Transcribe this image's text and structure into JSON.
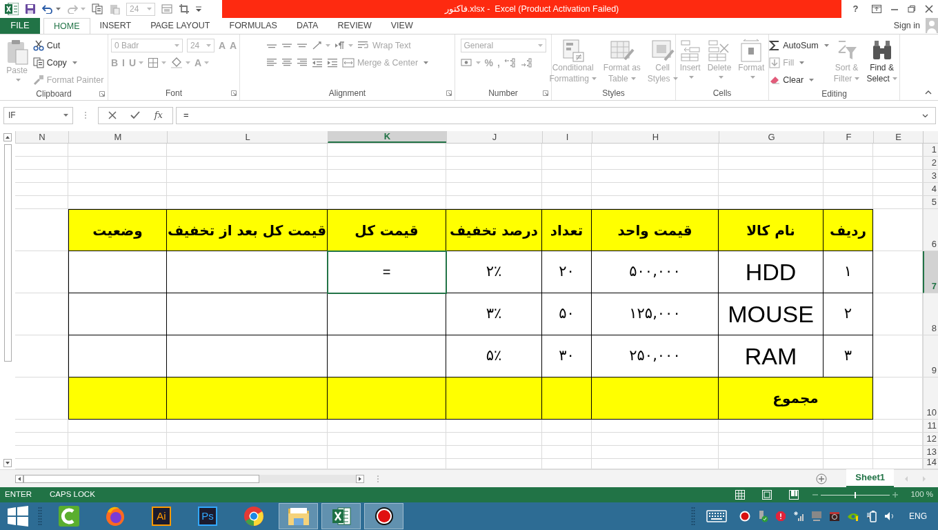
{
  "title_bar": {
    "font_size": "24",
    "title": "فاکتور.xlsx -  Excel (Product Activation Failed)",
    "help": "?"
  },
  "tabs": [
    {
      "label": "FILE",
      "kind": "file",
      "selected": false
    },
    {
      "label": "HOME",
      "kind": "tab",
      "selected": true
    },
    {
      "label": "INSERT",
      "kind": "tab",
      "selected": false
    },
    {
      "label": "PAGE LAYOUT",
      "kind": "tab",
      "selected": false
    },
    {
      "label": "FORMULAS",
      "kind": "tab",
      "selected": false
    },
    {
      "label": "DATA",
      "kind": "tab",
      "selected": false
    },
    {
      "label": "REVIEW",
      "kind": "tab",
      "selected": false
    },
    {
      "label": "VIEW",
      "kind": "tab",
      "selected": false
    }
  ],
  "account": {
    "label": "Sign in"
  },
  "ribbon": {
    "groups": [
      {
        "label": "Clipboard",
        "launcher": true,
        "columns": [
          {
            "kind": "large",
            "label": "Paste",
            "caret": true,
            "disabled": true
          },
          {
            "kind": "stack",
            "lines": [
              {
                "controls": [
                  {
                    "kind": "button",
                    "label": "Cut",
                    "caret": false,
                    "disabled": false
                  }
                ]
              },
              {
                "controls": [
                  {
                    "kind": "button",
                    "label": "Copy",
                    "caret": true,
                    "disabled": false
                  }
                ]
              },
              {
                "controls": [
                  {
                    "kind": "button",
                    "label": "Format Painter",
                    "caret": false,
                    "disabled": true
                  }
                ]
              }
            ]
          }
        ]
      },
      {
        "label": "Font",
        "launcher": true,
        "columns": [
          {
            "kind": "stack",
            "lines": [
              {
                "controls": [
                  {
                    "kind": "field",
                    "value": "0 Badr",
                    "wide": true,
                    "disabled": true
                  },
                  {
                    "kind": "field",
                    "value": "24",
                    "wide": false,
                    "disabled": true
                  },
                  {
                    "kind": "glyph",
                    "label": "A",
                    "caret": false,
                    "disabled": true
                  },
                  {
                    "kind": "glyph",
                    "label": "A",
                    "caret": false,
                    "disabled": true
                  }
                ]
              },
              {
                "controls": [
                  {
                    "kind": "glyph",
                    "label": "B",
                    "caret": false,
                    "disabled": true
                  },
                  {
                    "kind": "glyph",
                    "label": "I",
                    "caret": false,
                    "disabled": true
                  },
                  {
                    "kind": "glyph",
                    "label": "U",
                    "caret": true,
                    "disabled": true
                  },
                  {
                    "kind": "icon",
                    "caret": true,
                    "disabled": true
                  },
                  {
                    "kind": "icon",
                    "caret": true,
                    "disabled": true
                  },
                  {
                    "kind": "glyph",
                    "label": "A",
                    "caret": true,
                    "disabled": true
                  }
                ]
              }
            ]
          }
        ]
      },
      {
        "label": "Alignment",
        "launcher": true,
        "columns": [
          {
            "kind": "stack",
            "lines": [
              {
                "controls": [
                  {
                    "kind": "icon",
                    "caret": false,
                    "disabled": true
                  },
                  {
                    "kind": "icon",
                    "caret": false,
                    "disabled": true
                  },
                  {
                    "kind": "icon",
                    "caret": false,
                    "disabled": true
                  },
                  {
                    "kind": "icon",
                    "caret": true,
                    "disabled": true
                  },
                  {
                    "kind": "icon",
                    "caret": true,
                    "disabled": true
                  },
                  {
                    "kind": "button",
                    "label": "Wrap Text",
                    "caret": false,
                    "disabled": true
                  }
                ]
              },
              {
                "controls": [
                  {
                    "kind": "icon",
                    "caret": false,
                    "disabled": true
                  },
                  {
                    "kind": "icon",
                    "caret": false,
                    "disabled": true
                  },
                  {
                    "kind": "icon",
                    "caret": false,
                    "disabled": true
                  },
                  {
                    "kind": "icon",
                    "caret": false,
                    "disabled": true
                  },
                  {
                    "kind": "icon",
                    "caret": false,
                    "disabled": true
                  },
                  {
                    "kind": "button",
                    "label": "Merge & Center",
                    "caret": true,
                    "disabled": true
                  }
                ]
              }
            ]
          }
        ]
      },
      {
        "label": "Number",
        "launcher": true,
        "columns": [
          {
            "kind": "stack",
            "lines": [
              {
                "controls": [
                  {
                    "kind": "field",
                    "value": "General",
                    "wide": true,
                    "disabled": true
                  }
                ]
              },
              {
                "controls": [
                  {
                    "kind": "icon",
                    "caret": true,
                    "disabled": true
                  },
                  {
                    "kind": "glyph",
                    "label": "%",
                    "caret": false,
                    "disabled": true
                  },
                  {
                    "kind": "glyph",
                    "label": ",",
                    "caret": false,
                    "disabled": true
                  },
                  {
                    "kind": "icon",
                    "caret": false,
                    "disabled": true
                  },
                  {
                    "kind": "icon",
                    "caret": false,
                    "disabled": true
                  }
                ]
              }
            ]
          }
        ]
      },
      {
        "label": "Styles",
        "launcher": false,
        "columns": [
          {
            "kind": "large",
            "label": "Conditional\nFormatting",
            "caret": true,
            "disabled": true
          },
          {
            "kind": "large",
            "label": "Format as\nTable",
            "caret": true,
            "disabled": true
          },
          {
            "kind": "large",
            "label": "Cell\nStyles",
            "caret": true,
            "disabled": true
          }
        ]
      },
      {
        "label": "Cells",
        "launcher": false,
        "columns": [
          {
            "kind": "large",
            "label": "Insert",
            "caret": true,
            "disabled": true
          },
          {
            "kind": "large",
            "label": "Delete",
            "caret": true,
            "disabled": true
          },
          {
            "kind": "large",
            "label": "Format",
            "caret": true,
            "disabled": true
          }
        ]
      },
      {
        "label": "Editing",
        "launcher": false,
        "columns": [
          {
            "kind": "stack",
            "lines": [
              {
                "controls": [
                  {
                    "kind": "button",
                    "label": "AutoSum",
                    "caret": true,
                    "disabled": false
                  }
                ]
              },
              {
                "controls": [
                  {
                    "kind": "button",
                    "label": "Fill",
                    "caret": true,
                    "disabled": true
                  }
                ]
              },
              {
                "controls": [
                  {
                    "kind": "button",
                    "label": "Clear",
                    "caret": true,
                    "disabled": false
                  }
                ]
              }
            ]
          },
          {
            "kind": "large",
            "label": "Sort &\nFilter",
            "caret": true,
            "disabled": true
          },
          {
            "kind": "large",
            "label": "Find &\nSelect",
            "caret": true,
            "disabled": false
          }
        ]
      }
    ]
  },
  "formula_bar": {
    "name_box": "IF",
    "function_label": "fx",
    "formula": "="
  },
  "sheet": {
    "columns": [
      {
        "label": "N",
        "selected": false
      },
      {
        "label": "M",
        "selected": false
      },
      {
        "label": "L",
        "selected": false
      },
      {
        "label": "K",
        "selected": true
      },
      {
        "label": "J",
        "selected": false
      },
      {
        "label": "I",
        "selected": false
      },
      {
        "label": "H",
        "selected": false
      },
      {
        "label": "G",
        "selected": false
      },
      {
        "label": "F",
        "selected": false
      },
      {
        "label": "E",
        "selected": false
      }
    ],
    "rows": [
      {
        "label": "1",
        "selected": false
      },
      {
        "label": "2",
        "selected": false
      },
      {
        "label": "3",
        "selected": false
      },
      {
        "label": "4",
        "selected": false
      },
      {
        "label": "5",
        "selected": false
      },
      {
        "label": "6",
        "selected": false
      },
      {
        "label": "7",
        "selected": true
      },
      {
        "label": "8",
        "selected": false
      },
      {
        "label": "9",
        "selected": false
      },
      {
        "label": "10",
        "selected": false
      },
      {
        "label": "11",
        "selected": false
      },
      {
        "label": "12",
        "selected": false
      },
      {
        "label": "13",
        "selected": false
      },
      {
        "label": "14",
        "selected": false
      }
    ],
    "invoice": {
      "headers": [
        "ردیف",
        "نام کالا",
        "قیمت واحد",
        "تعداد",
        "درصد تخفیف",
        "قیمت کل",
        "قیمت کل بعد از تخفیف",
        "وضعیت"
      ],
      "rows": [
        {
          "total_price": "=",
          "total_selected": true,
          "discount": "۲٪",
          "quantity": "۲۰",
          "unit_price": "۵۰۰,۰۰۰",
          "item": "HDD",
          "number": "۱"
        },
        {
          "total_selected": false,
          "discount": "۳٪",
          "quantity": "۵۰",
          "unit_price": "۱۲۵,۰۰۰",
          "item": "MOUSE",
          "number": "۲"
        },
        {
          "total_selected": false,
          "discount": "۵٪",
          "quantity": "۳۰",
          "unit_price": "۲۵۰,۰۰۰",
          "item": "RAM",
          "number": "۳"
        }
      ],
      "total_label": "مجموع"
    }
  },
  "sheet_tabs": [
    {
      "label": "Sheet1",
      "selected": true
    }
  ],
  "status_bar": {
    "mode": "ENTER",
    "caps_lock": "CAPS LOCK",
    "zoom": {
      "level": 0.5,
      "reading": "100 %"
    }
  },
  "taskbar": {
    "apps": [
      {
        "kind": "app",
        "active": false
      },
      {
        "kind": "browser-fox",
        "active": false
      },
      {
        "kind": "text-logo",
        "label": "Ai",
        "color": "#ff9a00",
        "active": false
      },
      {
        "kind": "text-logo",
        "label": "Ps",
        "color": "#31a8ff",
        "active": false
      },
      {
        "kind": "browser-ring",
        "active": false
      },
      {
        "kind": "folder",
        "active": true
      },
      {
        "kind": "spreadsheet",
        "active": true
      },
      {
        "kind": "record",
        "active": true
      }
    ],
    "language": "ENG"
  }
}
